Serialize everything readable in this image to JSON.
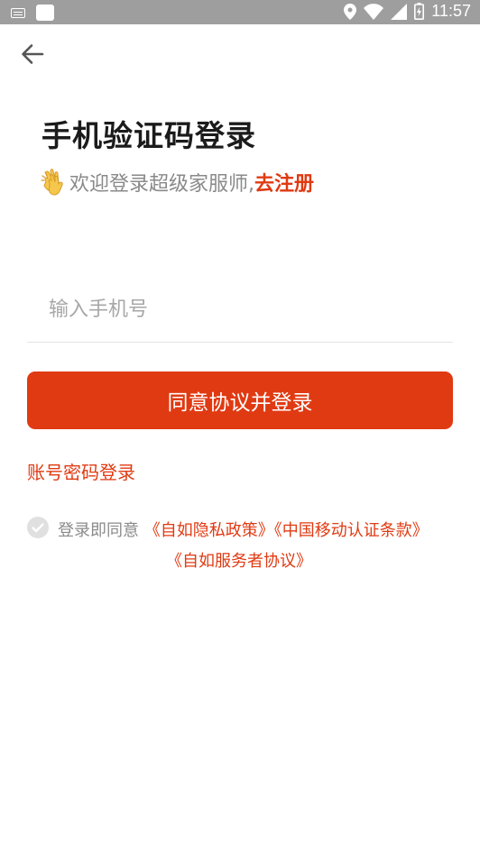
{
  "status_bar": {
    "time": "11:57",
    "icons": [
      "keyboard-icon",
      "app-notification-icon",
      "location-icon",
      "wifi-icon",
      "signal-icon",
      "battery-icon"
    ]
  },
  "header": {
    "back_icon": "arrow-left-icon"
  },
  "main": {
    "title": "手机验证码登录",
    "subtitle_icon": "clapping-hands-icon",
    "subtitle_text": "欢迎登录超级家服师,",
    "register_link": "去注册",
    "phone_input": {
      "placeholder": "输入手机号",
      "value": ""
    },
    "login_button": "同意协议并登录",
    "password_login_link": "账号密码登录",
    "agreement": {
      "prefix": "登录即同意",
      "privacy_policy": "《自如隐私政策》",
      "cmcc_terms": "《中国移动认证条款》",
      "service_agreement": "《自如服务者协议》"
    }
  },
  "colors": {
    "accent": "#e03a12",
    "status_bar": "#9e9e9e",
    "title": "#1b1b1b",
    "muted": "#8a8a8a"
  }
}
